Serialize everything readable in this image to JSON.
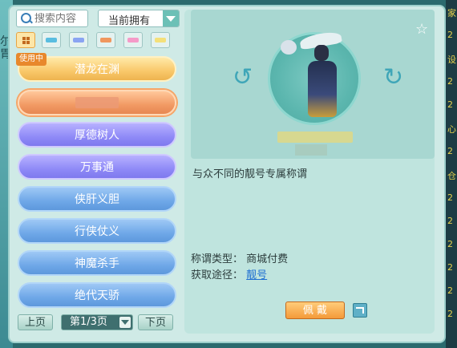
{
  "search": {
    "placeholder": "搜索内容"
  },
  "filter": {
    "selected": "当前拥有"
  },
  "color_filters": [
    "all",
    "cyan",
    "blue",
    "orange",
    "pink",
    "yellow"
  ],
  "badge": {
    "label": "使用中"
  },
  "titles": [
    {
      "label": "潜龙在渊",
      "style": "gold"
    },
    {
      "label": "",
      "style": "orange"
    },
    {
      "label": "厚德树人",
      "style": "violet"
    },
    {
      "label": "万事通",
      "style": "violet"
    },
    {
      "label": "侠肝义胆",
      "style": "bluec"
    },
    {
      "label": "行侠仗义",
      "style": "bluec"
    },
    {
      "label": "神魔杀手",
      "style": "bluec"
    },
    {
      "label": "绝代天骄",
      "style": "bluec"
    }
  ],
  "pager": {
    "prev": "上页",
    "page": "第1/3页",
    "next": "下页"
  },
  "preview": {
    "favorite_icon": "star-icon"
  },
  "detail": {
    "description": "与众不同的靓号专属称谓",
    "type_label": "称谓类型：",
    "type_value": "商城付费",
    "source_label": "获取途径：",
    "source_value": "靓号"
  },
  "actions": {
    "wear": "佩 戴"
  },
  "edge_text": {
    "left": "尔\n胃",
    "right": [
      "家",
      "2",
      "设",
      "2",
      "2",
      "心",
      "2",
      "仓",
      "2",
      "2",
      "2",
      "2",
      "2",
      "2"
    ]
  }
}
